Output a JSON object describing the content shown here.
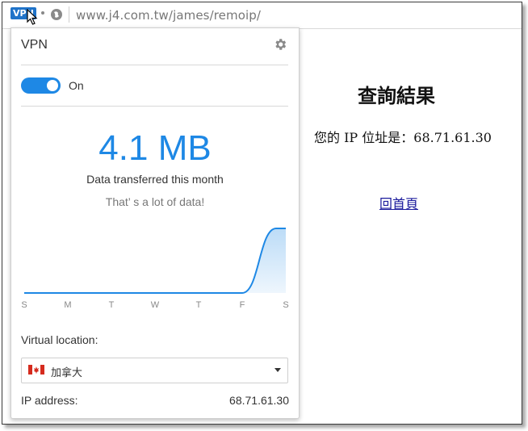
{
  "browser": {
    "vpn_badge": "VPN",
    "url": "www.j4.com.tw/james/remoip/"
  },
  "page": {
    "title": "查詢結果",
    "ip_line": "您的 IP 位址是：68.71.61.30",
    "home_link": "回首頁"
  },
  "vpn_panel": {
    "title": "VPN",
    "toggle_state": "On",
    "data_amount": "4.1 MB",
    "data_caption": "Data transferred this month",
    "data_note": "That’ s a lot of data!",
    "chart_data": {
      "type": "area",
      "categories": [
        "S",
        "M",
        "T",
        "W",
        "T",
        "F",
        "S"
      ],
      "values": [
        0,
        0,
        0,
        0,
        0,
        0,
        4.1
      ],
      "color": "#1e88e5"
    },
    "location_label": "Virtual location:",
    "location_value": "加拿大",
    "location_flag": "canada-flag",
    "ip_label": "IP address:",
    "ip_value": "68.71.61.30"
  }
}
